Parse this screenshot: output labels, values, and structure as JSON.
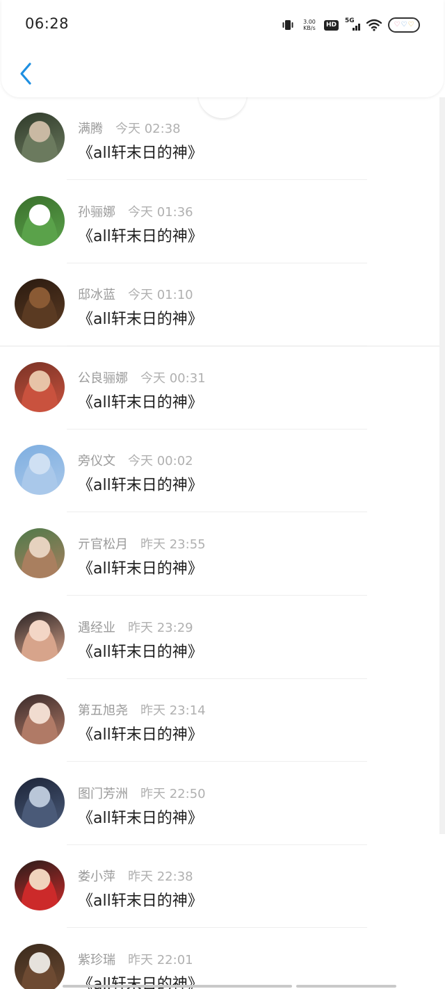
{
  "status_bar": {
    "time": "06:28",
    "net_speed_value": "3.00",
    "net_speed_unit": "KB/s",
    "hd_label": "HD",
    "network_label": "5G",
    "icons": [
      "vibrate-icon",
      "net-speed",
      "hd-icon",
      "5g-signal-icon",
      "wifi-icon",
      "battery-icon"
    ]
  },
  "nav": {
    "back_icon": "chevron-left-icon",
    "accent": "#1e8fe1"
  },
  "messages": [
    {
      "name": "满腾",
      "time": "今天 02:38",
      "text": "《all轩末日的神》",
      "avatar": [
        "#c9b9a3",
        "#6b7a5e",
        "#2f3a2a"
      ]
    },
    {
      "name": "孙骊娜",
      "time": "今天 01:36",
      "text": "《all轩末日的神》",
      "avatar": [
        "#ffffff",
        "#5aa24a",
        "#3a6f2c"
      ]
    },
    {
      "name": "邸冰蓝",
      "time": "今天 01:10",
      "text": "《all轩末日的神》",
      "avatar": [
        "#8a5a34",
        "#5a3a22",
        "#2a1a10"
      ]
    },
    {
      "name": "公良骊娜",
      "time": "今天 00:31",
      "text": "《all轩末日的神》",
      "avatar": [
        "#e7c3a7",
        "#c9523e",
        "#7a3326"
      ]
    },
    {
      "name": "旁仪文",
      "time": "今天 00:02",
      "text": "《all轩末日的神》",
      "avatar": [
        "#cfe0f3",
        "#a9c8ea",
        "#7eaee0"
      ]
    },
    {
      "name": "亓官松月",
      "time": "昨天 23:55",
      "text": "《all轩末日的神》",
      "avatar": [
        "#e6d2bf",
        "#a97f5f",
        "#4f7a4a"
      ]
    },
    {
      "name": "遇经业",
      "time": "昨天 23:29",
      "text": "《all轩末日的神》",
      "avatar": [
        "#f3d6c6",
        "#d7a48b",
        "#2a2223"
      ]
    },
    {
      "name": "第五旭尧",
      "time": "昨天 23:14",
      "text": "《all轩末日的神》",
      "avatar": [
        "#f1dcd0",
        "#b07a66",
        "#3a2a2a"
      ]
    },
    {
      "name": "图门芳洲",
      "time": "昨天 22:50",
      "text": "《all轩末日的神》",
      "avatar": [
        "#b9c6d8",
        "#4a5a78",
        "#1c2438"
      ]
    },
    {
      "name": "娄小萍",
      "time": "昨天 22:38",
      "text": "《all轩末日的神》",
      "avatar": [
        "#f0d3bd",
        "#cc2a2a",
        "#2a1d1a"
      ]
    },
    {
      "name": "紫珍瑞",
      "time": "昨天 22:01",
      "text": "《all轩末日的神》",
      "avatar": [
        "#e6e2dc",
        "#6d4a32",
        "#3a2a1c"
      ]
    }
  ]
}
